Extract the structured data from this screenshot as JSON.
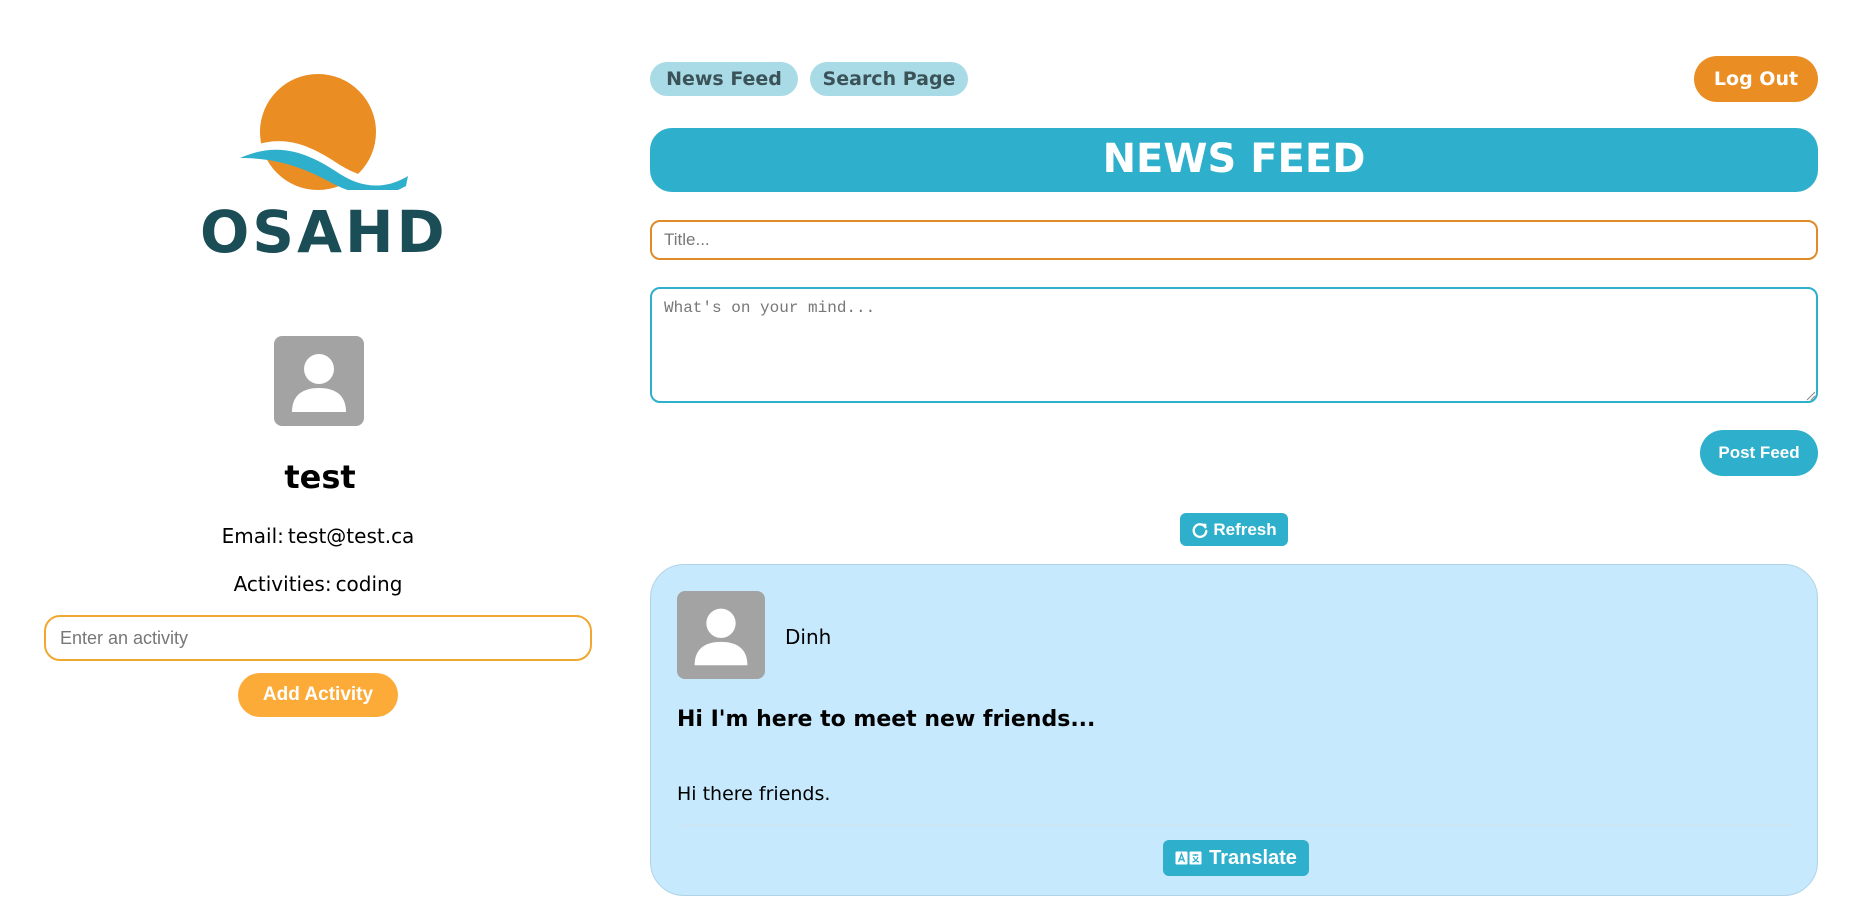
{
  "brand": {
    "logo_text": "OSAHD",
    "colors": {
      "sun": "#ea8e24",
      "wave": "#2eafcb",
      "text": "#1b4d57"
    }
  },
  "profile": {
    "username": "test",
    "email_label": "Email:",
    "email": "test@test.ca",
    "activities_label": "Activities:",
    "activities": "coding",
    "activity_input_placeholder": "Enter an activity",
    "add_activity_label": "Add Activity"
  },
  "nav": {
    "tabs": [
      {
        "label": "News Feed"
      },
      {
        "label": "Search Page"
      }
    ],
    "logout_label": "Log Out"
  },
  "feed": {
    "heading": "NEWS FEED",
    "title_placeholder": "Title...",
    "body_placeholder": "What's on your mind...",
    "post_button_label": "Post Feed",
    "refresh_label": "Refresh",
    "refresh_icon": "refresh-icon"
  },
  "posts": [
    {
      "author": "Dinh",
      "title": "Hi I'm here to meet new friends...",
      "body": "Hi there friends.",
      "translate_label": "Translate",
      "translate_icon": "translate-icon"
    }
  ],
  "theme": {
    "primary": "#2eafcb",
    "accent_orange": "#ea8e24",
    "accent_yellow": "#fcab38",
    "nav_pill": "#a8dbe6",
    "card_bg": "#c6e9fd"
  }
}
